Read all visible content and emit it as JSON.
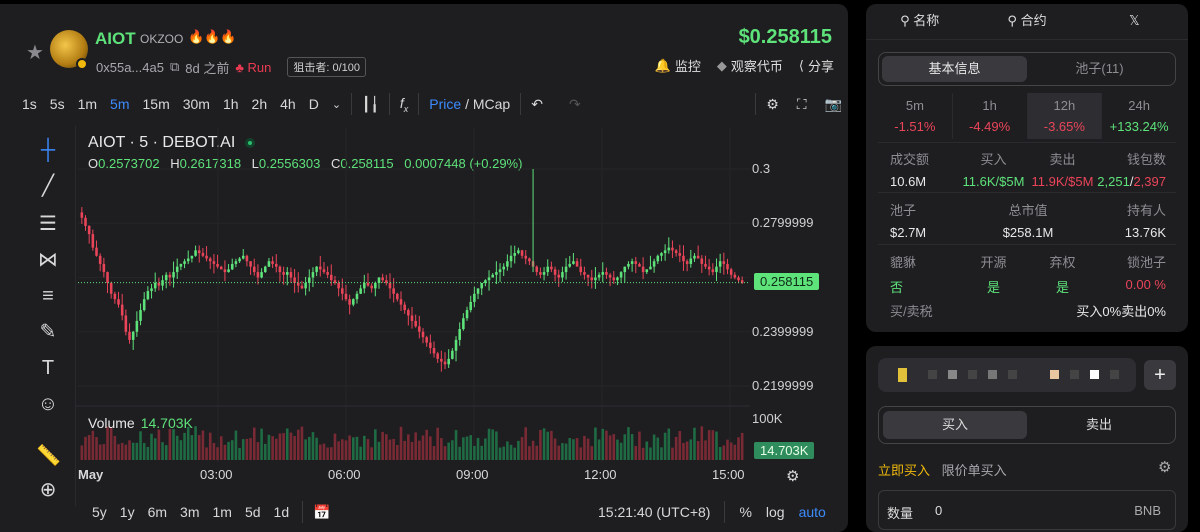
{
  "token": {
    "name": "AIOT",
    "sub": "OKZOO",
    "flames": "🔥🔥🔥",
    "address": "0x55a...4a5",
    "age": "8d 之前",
    "run": "Run",
    "sniper": "狙击者: 0/100",
    "price": "$0.258115"
  },
  "header_actions": {
    "watch": "监控",
    "watch_coin": "观察代币",
    "share": "分享"
  },
  "toolbar": {
    "timeframes": [
      "1s",
      "5s",
      "1m",
      "5m",
      "15m",
      "30m",
      "1h",
      "2h",
      "4h",
      "D"
    ],
    "active_timeframe": "5m",
    "price_label": "Price",
    "slash": "/",
    "mcap_label": "MCap"
  },
  "legend": {
    "title": "AIOT · 5 · DEBOT.AI",
    "o_label": "O",
    "o": "0.2573702",
    "h_label": "H",
    "h": "0.2617318",
    "l_label": "L",
    "l": "0.2556303",
    "c_label": "C",
    "c": "0.258115",
    "change": "0.0007448 (+0.29%)"
  },
  "volume": {
    "label": "Volume",
    "value": "14.703K"
  },
  "y_ticks": [
    "0.3",
    "0.2799999",
    "0.2399999",
    "0.2199999"
  ],
  "vol_tick": "100K",
  "price_tag": "0.258115",
  "vol_tag": "14.703K",
  "x_ticks": [
    "May",
    "03:00",
    "06:00",
    "09:00",
    "12:00",
    "15:00"
  ],
  "ranges": [
    "5y",
    "1y",
    "6m",
    "3m",
    "1m",
    "5d",
    "1d"
  ],
  "clock": "15:21:40 (UTC+8)",
  "scale_opts": {
    "pct": "%",
    "log": "log",
    "auto": "auto"
  },
  "chart_data": {
    "type": "candlestick",
    "interval": "5m",
    "ylim": [
      0.215,
      0.305
    ],
    "last_close": 0.258115,
    "volume_axis_max": 100000,
    "closes": [
      0.282,
      0.279,
      0.276,
      0.271,
      0.268,
      0.265,
      0.262,
      0.258,
      0.254,
      0.252,
      0.25,
      0.246,
      0.24,
      0.237,
      0.24,
      0.244,
      0.248,
      0.252,
      0.255,
      0.256,
      0.258,
      0.257,
      0.259,
      0.261,
      0.26,
      0.262,
      0.264,
      0.265,
      0.266,
      0.267,
      0.268,
      0.27,
      0.269,
      0.268,
      0.267,
      0.266,
      0.265,
      0.264,
      0.263,
      0.262,
      0.263,
      0.265,
      0.266,
      0.267,
      0.268,
      0.266,
      0.264,
      0.262,
      0.26,
      0.262,
      0.264,
      0.266,
      0.265,
      0.264,
      0.262,
      0.261,
      0.262,
      0.26,
      0.258,
      0.257,
      0.256,
      0.258,
      0.26,
      0.262,
      0.264,
      0.263,
      0.262,
      0.261,
      0.259,
      0.258,
      0.256,
      0.254,
      0.252,
      0.25,
      0.252,
      0.254,
      0.256,
      0.258,
      0.257,
      0.256,
      0.258,
      0.26,
      0.259,
      0.258,
      0.256,
      0.254,
      0.252,
      0.25,
      0.248,
      0.246,
      0.244,
      0.242,
      0.24,
      0.238,
      0.236,
      0.234,
      0.232,
      0.23,
      0.229,
      0.228,
      0.23,
      0.233,
      0.237,
      0.241,
      0.245,
      0.248,
      0.251,
      0.254,
      0.256,
      0.258,
      0.259,
      0.26,
      0.261,
      0.262,
      0.263,
      0.264,
      0.266,
      0.268,
      0.269,
      0.27,
      0.268,
      0.267,
      0.266,
      0.264,
      0.262,
      0.261,
      0.262,
      0.264,
      0.263,
      0.261,
      0.26,
      0.262,
      0.264,
      0.265,
      0.266,
      0.264,
      0.262,
      0.261,
      0.26,
      0.259,
      0.26,
      0.261,
      0.262,
      0.261,
      0.26,
      0.259,
      0.26,
      0.262,
      0.264,
      0.265,
      0.266,
      0.265,
      0.264,
      0.262,
      0.263,
      0.264,
      0.266,
      0.268,
      0.269,
      0.27,
      0.271,
      0.27,
      0.269,
      0.268,
      0.266,
      0.265,
      0.267,
      0.268,
      0.267,
      0.265,
      0.264,
      0.263,
      0.262,
      0.264,
      0.266,
      0.265,
      0.263,
      0.261,
      0.26,
      0.259,
      0.258
    ]
  },
  "right_tabs": {
    "name": "名称",
    "contract": "合约",
    "x": "𝕏"
  },
  "info_tabs": {
    "basic": "基本信息",
    "pools": "池子(11)"
  },
  "periods": [
    {
      "label": "5m",
      "value": "-1.51%",
      "dir": "neg"
    },
    {
      "label": "1h",
      "value": "-4.49%",
      "dir": "neg"
    },
    {
      "label": "12h",
      "value": "-3.65%",
      "dir": "neg"
    },
    {
      "label": "24h",
      "value": "+133.24%",
      "dir": "pos"
    }
  ],
  "stats1": {
    "h1": "成交额",
    "h2": "买入",
    "h3": "卖出",
    "h4": "钱包数",
    "v1": "10.6M",
    "v2": "11.6K/$5M",
    "v3": "11.9K/$5M",
    "v4a": "2,251",
    "v4sep": "/",
    "v4b": "2,397"
  },
  "stats2": {
    "h1": "池子",
    "h2": "总市值",
    "h3": "持有人",
    "v1": "$2.7M",
    "v2": "$258.1M",
    "v3": "13.76K"
  },
  "stats3": {
    "h1": "貔貅",
    "h2": "开源",
    "h3": "弃权",
    "h4": "锁池子",
    "v1": "否",
    "v2": "是",
    "v3": "是",
    "v4": "0.00 %"
  },
  "tax": {
    "label": "买/卖税",
    "value": "买入0%卖出0%"
  },
  "trade": {
    "plus": "+",
    "buy": "买入",
    "sell": "卖出",
    "instant": "立即买入",
    "limit": "限价单买入",
    "qty_label": "数量",
    "qty_value": "0",
    "currency": "BNB"
  },
  "colors": {
    "up": "#5ee27a",
    "down": "#ea4459",
    "accent": "#3c8bfd",
    "gold": "#f0b90b"
  }
}
